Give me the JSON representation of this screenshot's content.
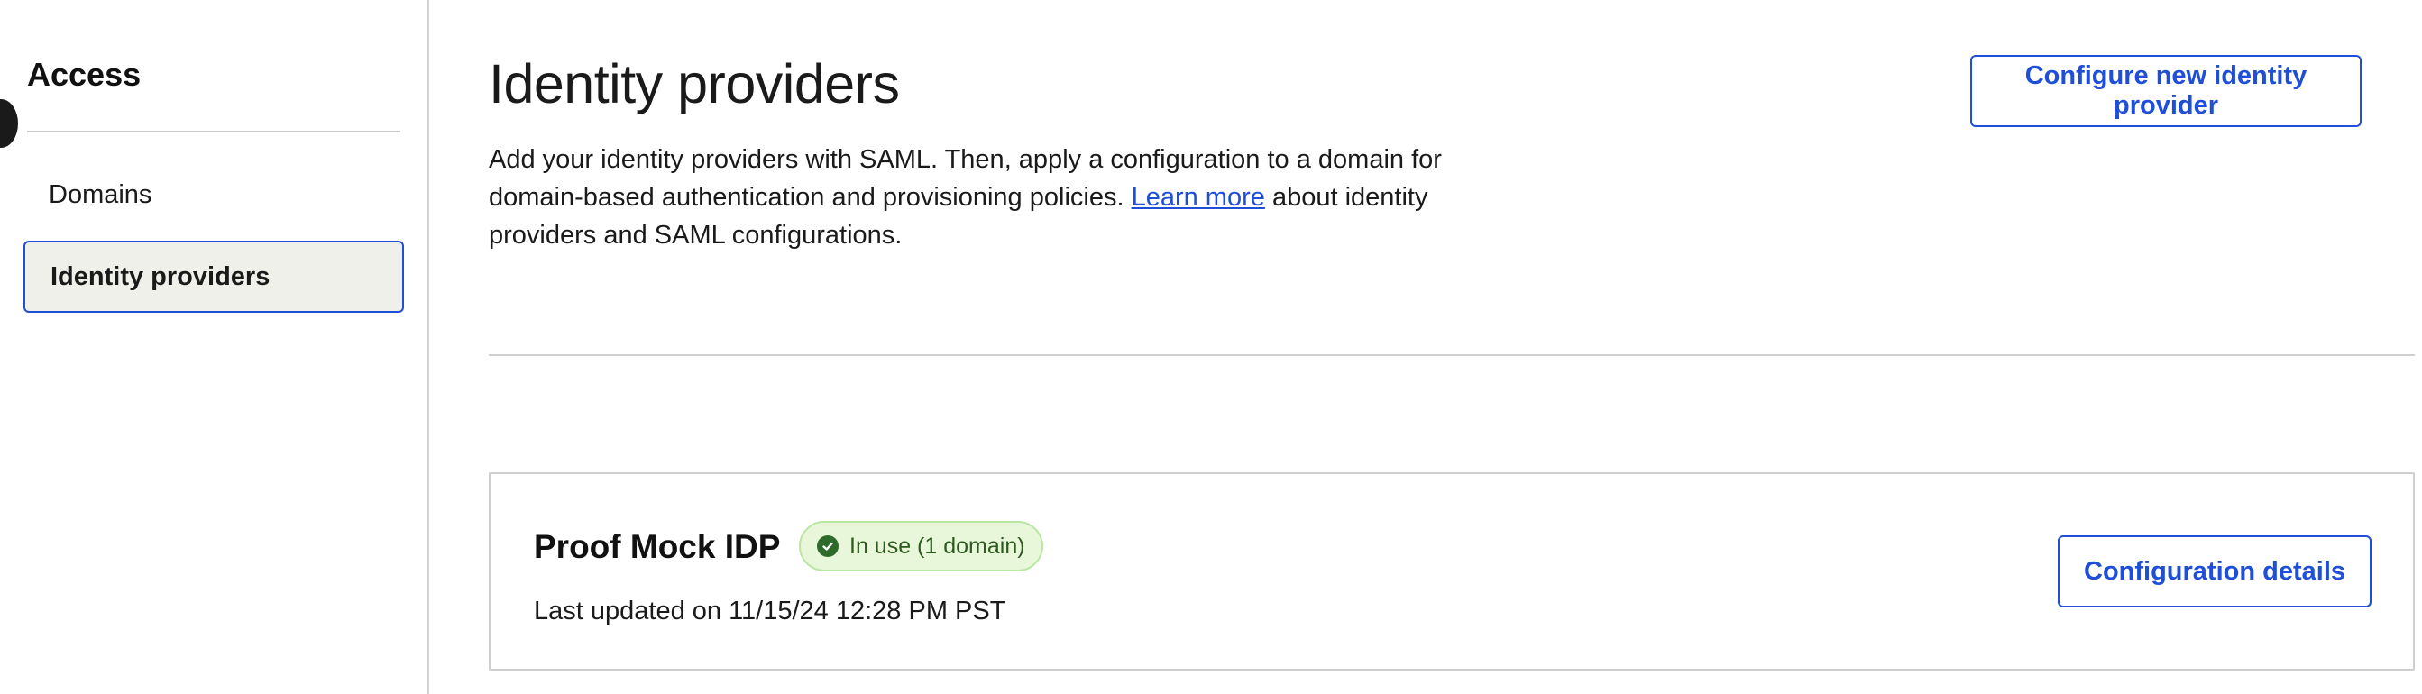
{
  "sidebar": {
    "title": "Access",
    "items": [
      {
        "label": "Domains",
        "selected": false
      },
      {
        "label": "Identity providers",
        "selected": true
      }
    ]
  },
  "main": {
    "title": "Identity providers",
    "description": {
      "before_link": "Add your identity providers with SAML. Then, apply a configuration to a domain for domain-based authentication and provisioning policies. ",
      "link_text": "Learn more",
      "after_link": " about identity providers and SAML configurations."
    },
    "configure_button": "Configure new identity provider",
    "providers": [
      {
        "name": "Proof Mock IDP",
        "status": "In use (1 domain)",
        "status_icon": "check-circle-icon",
        "updated": "Last updated on 11/15/24 12:28 PM PST",
        "details_button": "Configuration details"
      }
    ]
  },
  "colors": {
    "accent": "#1f4fd8",
    "badge_bg": "#e8f7d9",
    "badge_text": "#2d5a1e",
    "selected_bg": "#f0f0eb"
  }
}
